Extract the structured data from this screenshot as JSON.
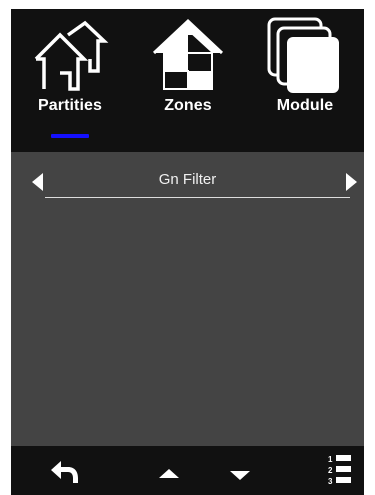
{
  "tabs": [
    {
      "label": "Partities",
      "icon": "house-outline-icon",
      "active": true
    },
    {
      "label": "Zones",
      "icon": "house-checkered-icon",
      "active": false
    },
    {
      "label": "Module",
      "icon": "stacked-pages-icon",
      "active": false
    }
  ],
  "filter": {
    "label": "Gn Filter"
  },
  "toolbar": {
    "back_icon": "back-arrow-icon",
    "up_icon": "triangle-up-icon",
    "down_icon": "triangle-down-icon",
    "list_icon": "numbered-list-icon",
    "list_numbers": [
      "1",
      "2",
      "3"
    ]
  },
  "colors": {
    "active_indicator": "#1410ff",
    "topbar": "#111111",
    "content": "#444444",
    "icon": "#ffffff"
  }
}
